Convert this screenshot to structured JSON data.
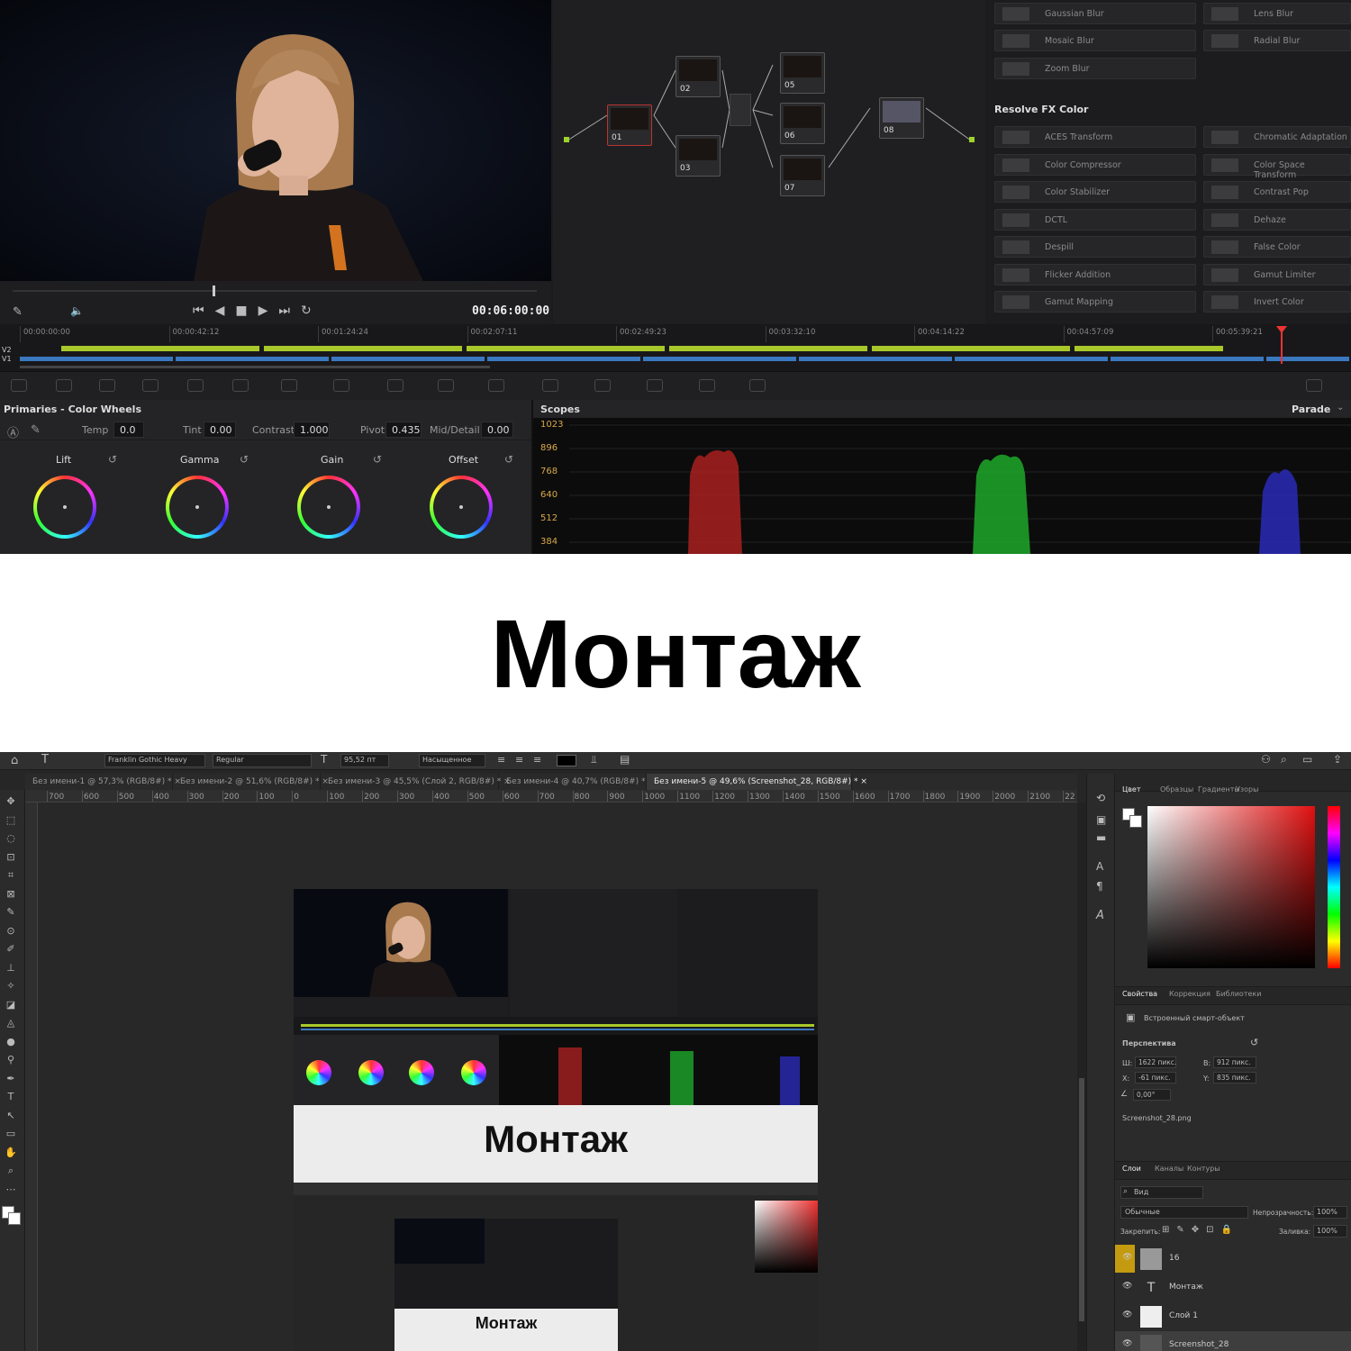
{
  "resolve": {
    "timecode": "00:06:00:00",
    "fx_blur": [
      "Gaussian Blur",
      "Lens Blur",
      "Mosaic Blur",
      "Radial Blur",
      "Zoom Blur"
    ],
    "fx_color_title": "Resolve FX Color",
    "fx_color": [
      "ACES Transform",
      "Chromatic Adaptation",
      "Color Compressor",
      "Color Space Transform",
      "Color Stabilizer",
      "Contrast Pop",
      "DCTL",
      "Dehaze",
      "Despill",
      "False Color",
      "Flicker Addition",
      "Gamut Limiter",
      "Gamut Mapping",
      "Invert Color"
    ],
    "nodes": [
      "01",
      "02",
      "03",
      "05",
      "06",
      "07",
      "08"
    ],
    "ruler": [
      "00:00:00:00",
      "00:00:42:12",
      "00:01:24:24",
      "00:02:07:11",
      "00:02:49:23",
      "00:03:32:10",
      "00:04:14:22",
      "00:04:57:09",
      "00:05:39:21"
    ],
    "tracks": [
      "V2",
      "V1"
    ],
    "primaries_title": "Primaries - Color Wheels",
    "params": {
      "temp_label": "Temp",
      "temp": "0.0",
      "tint_label": "Tint",
      "tint": "0.00",
      "contrast_label": "Contrast",
      "contrast": "1.000",
      "pivot_label": "Pivot",
      "pivot": "0.435",
      "middetail_label": "Mid/Detail",
      "middetail": "0.00"
    },
    "wheels": [
      "Lift",
      "Gamma",
      "Gain",
      "Offset"
    ],
    "scopes_title": "Scopes",
    "scopes_mode": "Parade",
    "scope_scale": [
      "1023",
      "896",
      "768",
      "640",
      "512",
      "384"
    ]
  },
  "title": "Монтаж",
  "photoshop": {
    "font_family": "Franklin Gothic Heavy",
    "font_style": "Regular",
    "font_size": "95,52 пт",
    "antialias": "Насыщенное",
    "tabs": [
      "Без имени-1 @ 57,3% (RGB/8#) *",
      "Без имени-2 @ 51,6% (RGB/8#) *",
      "Без имени-3 @ 45,5% (Слой 2, RGB/8#) *",
      "Без имени-4 @ 40,7% (RGB/8#) *",
      "Без имени-5 @ 49,6% (Screenshot_28, RGB/8#) *"
    ],
    "ruler": [
      "700",
      "600",
      "500",
      "400",
      "300",
      "200",
      "100",
      "0",
      "100",
      "200",
      "300",
      "400",
      "500",
      "600",
      "700",
      "800",
      "900",
      "1000",
      "1100",
      "1200",
      "1300",
      "1400",
      "1500",
      "1600",
      "1700",
      "1800",
      "1900",
      "2000",
      "2100",
      "22"
    ],
    "color_tabs": [
      "Цвет",
      "Образцы",
      "Градиенты",
      "Узоры"
    ],
    "props_tabs": [
      "Свойства",
      "Коррекция",
      "Библиотеки"
    ],
    "smart_object": "Встроенный смарт-объект",
    "perspective": "Перспектива",
    "w_label": "Ш:",
    "w": "1622 пикс.",
    "h_label": "В:",
    "h": "912 пикс.",
    "x_label": "X:",
    "x": "-61 пикс.",
    "y_label": "Y:",
    "y": "835 пикс.",
    "angle": "0,00°",
    "filename": "Screenshot_28.png",
    "layers_tabs": [
      "Слои",
      "Каналы",
      "Контуры"
    ],
    "search": "Вид",
    "blend": "Обычные",
    "opacity_label": "Непрозрачность:",
    "opacity": "100%",
    "lock_label": "Закрепить:",
    "fill_label": "Заливка:",
    "fill": "100%",
    "layers": [
      "16",
      "Монтаж",
      "Слой 1",
      "Screenshot_28"
    ],
    "inner_title": "Монтаж"
  }
}
